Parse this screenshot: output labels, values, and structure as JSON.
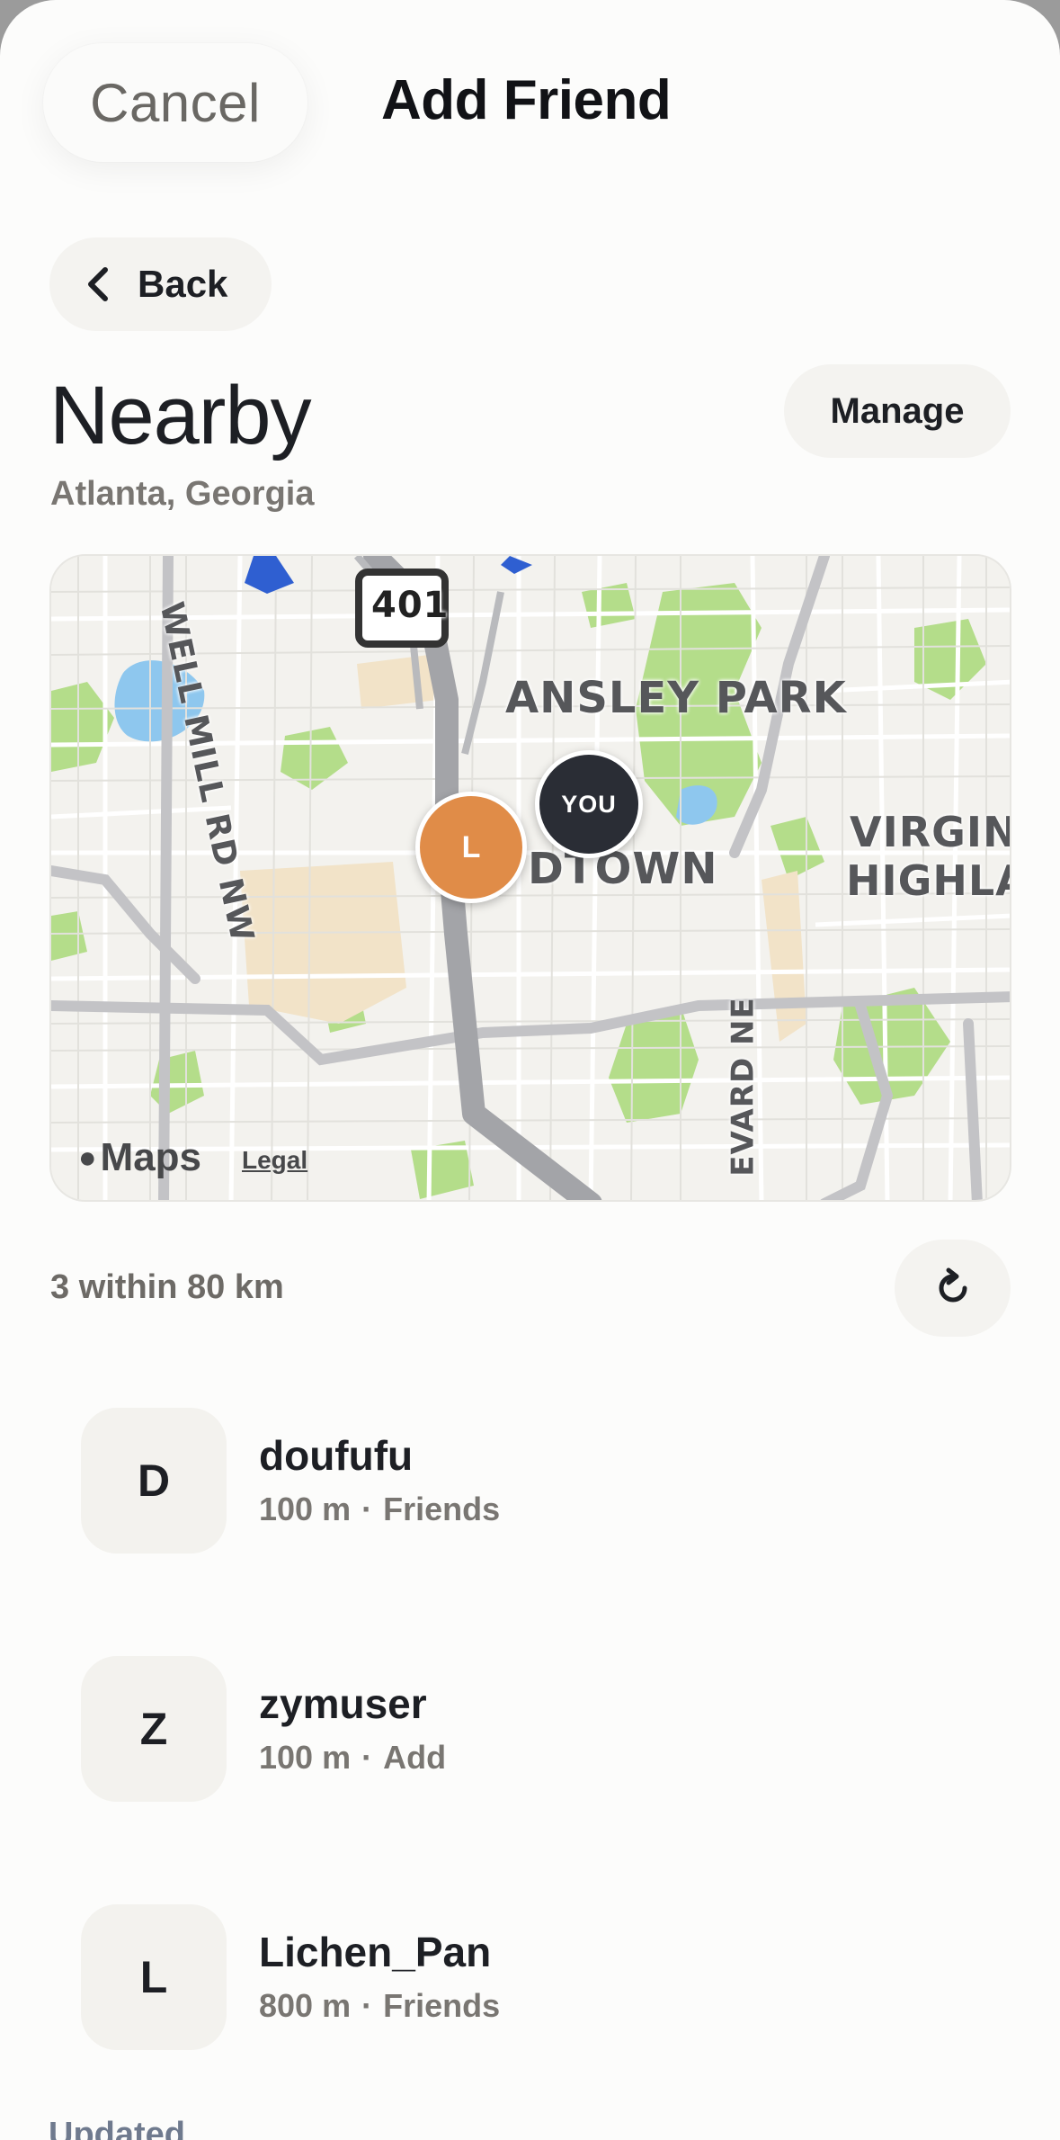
{
  "header": {
    "cancel_label": "Cancel",
    "title": "Add Friend"
  },
  "nav": {
    "back_label": "Back"
  },
  "section": {
    "title": "Nearby",
    "location": "Atlanta, Georgia",
    "manage_label": "Manage"
  },
  "map": {
    "you_marker": "YOU",
    "friend_marker": "L",
    "you_marker_color": "#2a2d35",
    "friend_marker_color": "#e08c48",
    "labels": {
      "ansley_park": "ANSLEY PARK",
      "midtown": "DTOWN",
      "virginia": "VIRGINIA",
      "highland": "HIGHLAN",
      "howell_mill": "WELL MILL RD NW",
      "boulevard": "EVARD NE",
      "route": "401"
    },
    "attribution": "Maps",
    "legal": "Legal"
  },
  "results": {
    "count_label": "3 within 80 km",
    "items": [
      {
        "initial": "D",
        "name": "doufufu",
        "distance": "100 m",
        "status": "Friends"
      },
      {
        "initial": "Z",
        "name": "zymuser",
        "distance": "100 m",
        "status": "Add"
      },
      {
        "initial": "L",
        "name": "Lichen_Pan",
        "distance": "800 m",
        "status": "Friends"
      }
    ],
    "updated_label": "Updated"
  },
  "icons": [
    "chevron-left-icon",
    "refresh-icon",
    "apple-icon"
  ],
  "colors": {
    "background": "#fcfcfb",
    "chip": "#f4f3f0",
    "text": "#1d1f24",
    "muted": "#797672"
  }
}
